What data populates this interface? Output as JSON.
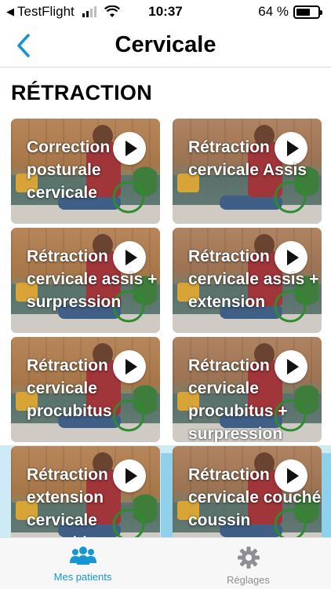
{
  "status_bar": {
    "back_app": "TestFlight",
    "time": "10:37",
    "battery": "64 %",
    "battery_level": 0.64,
    "signal_bars": 2
  },
  "nav": {
    "title": "Cervicale",
    "accent_color": "#1796d4"
  },
  "section": {
    "title": "RÉTRACTION"
  },
  "exercises": [
    {
      "title": "Correction posturale cervicale"
    },
    {
      "title": "Rétraction cervicale Assis"
    },
    {
      "title": "Rétraction cervicale assis + surpression"
    },
    {
      "title": "Rétraction cervicale assis + extension"
    },
    {
      "title": "Rétraction cervicale procubitus"
    },
    {
      "title": "Rétraction cervicale procubitus + surpression"
    },
    {
      "title": "Rétraction extension cervicale procubitus"
    },
    {
      "title": "Rétraction cervicale couché coussin"
    }
  ],
  "tabs": [
    {
      "label": "Mes patients",
      "icon": "patients-icon",
      "active": true
    },
    {
      "label": "Réglages",
      "icon": "gear-icon",
      "active": false
    }
  ],
  "colors": {
    "accent": "#1796d4",
    "progress_ring": "#2e8b2e",
    "tab_inactive": "#8e8e93"
  }
}
